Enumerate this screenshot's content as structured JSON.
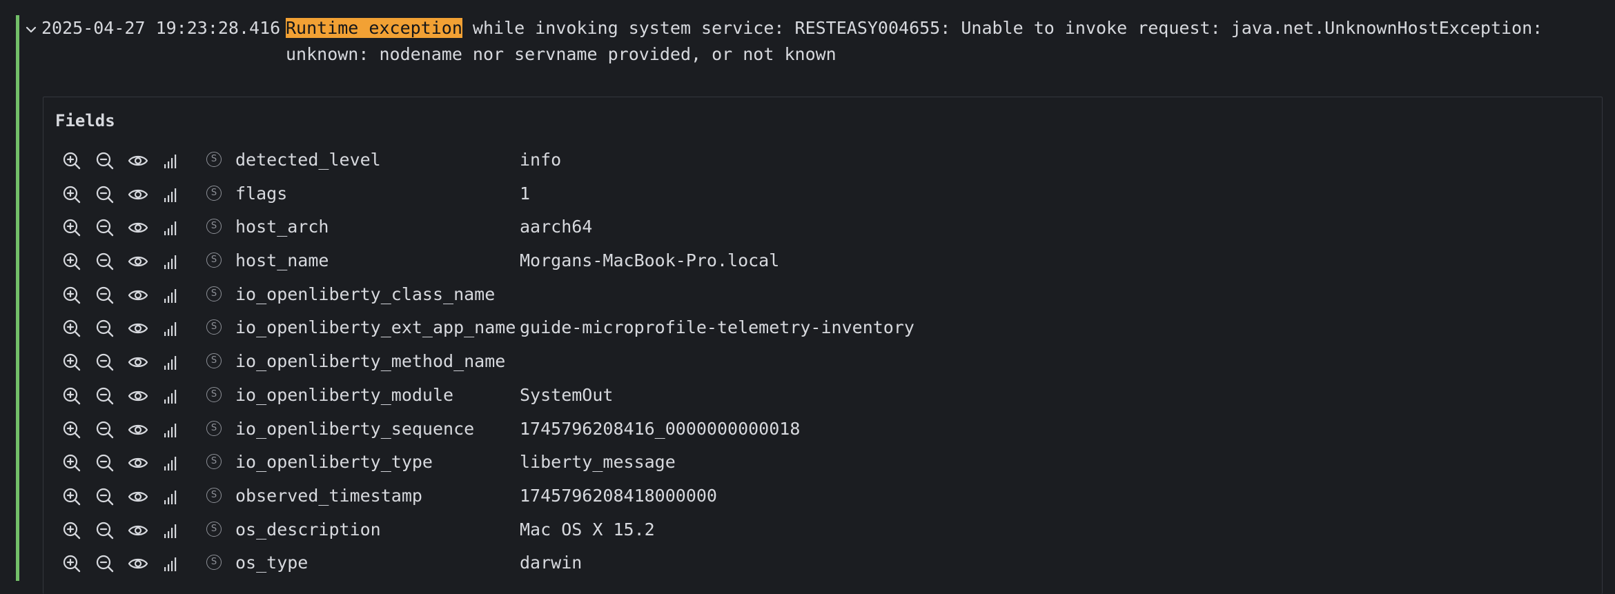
{
  "log": {
    "timestamp": "2025-04-27 19:23:28.416",
    "highlight": "Runtime exception",
    "message": " while invoking system service: RESTEASY004655: Unable to invoke request: java.net.UnknownHostException: unknown: nodename nor servname provided, or not known",
    "level_color": "#73bf69",
    "highlight_color": "#f2a134"
  },
  "details": {
    "title": "Fields",
    "type_badge": "S",
    "action_icons": [
      "zoom-in-icon",
      "zoom-out-icon",
      "eye-icon",
      "stats-icon"
    ],
    "fields": [
      {
        "name": "detected_level",
        "value": "info"
      },
      {
        "name": "flags",
        "value": "1"
      },
      {
        "name": "host_arch",
        "value": "aarch64"
      },
      {
        "name": "host_name",
        "value": "Morgans-MacBook-Pro.local"
      },
      {
        "name": "io_openliberty_class_name",
        "value": ""
      },
      {
        "name": "io_openliberty_ext_app_name",
        "value": "guide-microprofile-telemetry-inventory"
      },
      {
        "name": "io_openliberty_method_name",
        "value": ""
      },
      {
        "name": "io_openliberty_module",
        "value": "SystemOut"
      },
      {
        "name": "io_openliberty_sequence",
        "value": "1745796208416_0000000000018"
      },
      {
        "name": "io_openliberty_type",
        "value": "liberty_message"
      },
      {
        "name": "observed_timestamp",
        "value": "1745796208418000000"
      },
      {
        "name": "os_description",
        "value": "Mac OS X 15.2"
      },
      {
        "name": "os_type",
        "value": "darwin"
      }
    ]
  }
}
